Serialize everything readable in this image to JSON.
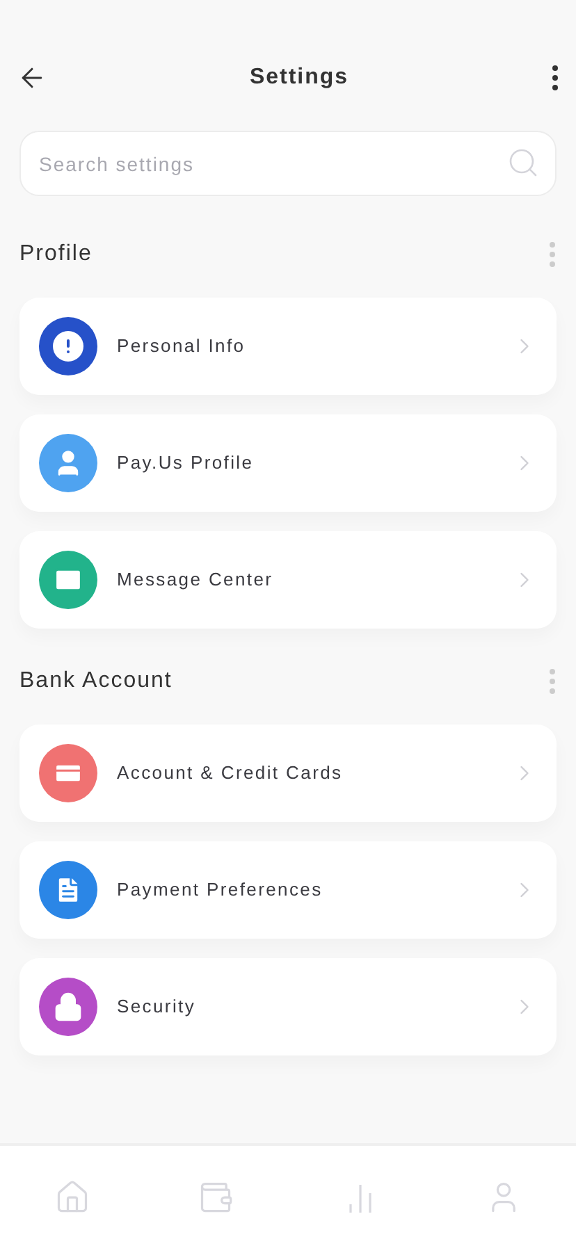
{
  "header": {
    "title": "Settings"
  },
  "search": {
    "placeholder": "Search settings"
  },
  "sections": [
    {
      "title": "Profile",
      "items": [
        {
          "label": "Personal Info",
          "color": "#2651c9"
        },
        {
          "label": "Pay.Us Profile",
          "color": "#4fa3f0"
        },
        {
          "label": "Message Center",
          "color": "#22b38b"
        }
      ]
    },
    {
      "title": "Bank Account",
      "items": [
        {
          "label": "Account & Credit Cards",
          "color": "#f07272"
        },
        {
          "label": "Payment Preferences",
          "color": "#2b86e6"
        },
        {
          "label": "Security",
          "color": "#b54dc7"
        }
      ]
    }
  ]
}
